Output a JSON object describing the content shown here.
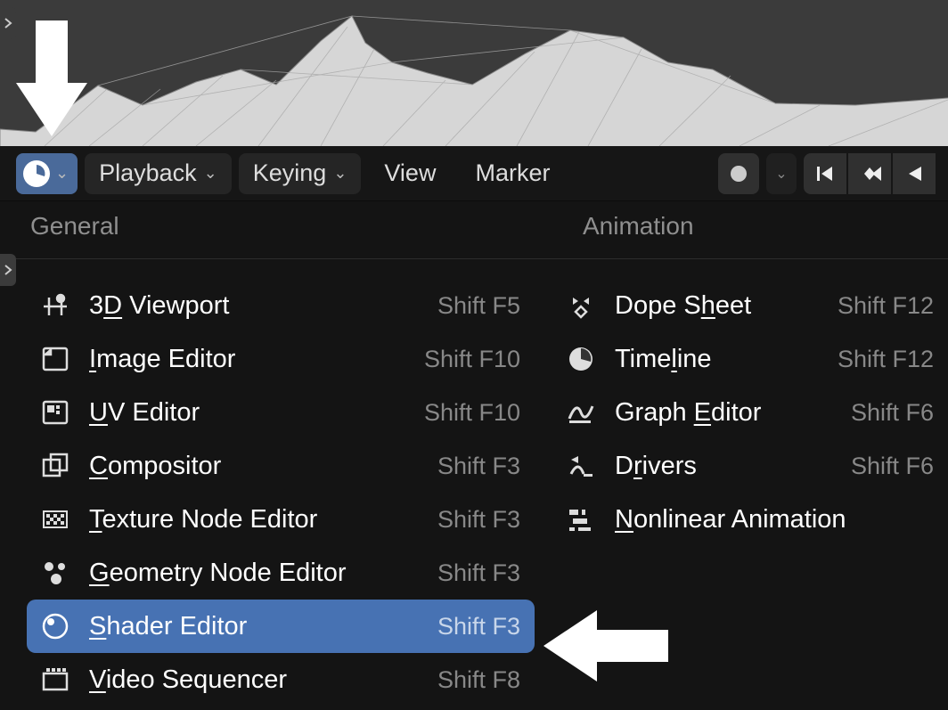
{
  "toolbar": {
    "editor_type_icon": "clock-icon",
    "playback": "Playback",
    "keying": "Keying",
    "view": "View",
    "marker": "Marker"
  },
  "dropdown": {
    "columns": [
      {
        "title": "General",
        "items": [
          {
            "icon": "viewport-3d-icon",
            "label_pre": "3",
            "label_ul": "D",
            "label_post": " Viewport",
            "shortcut": "Shift F5",
            "selected": false
          },
          {
            "icon": "image-editor-icon",
            "label_pre": "",
            "label_ul": "I",
            "label_post": "mage Editor",
            "shortcut": "Shift F10",
            "selected": false
          },
          {
            "icon": "uv-editor-icon",
            "label_pre": "",
            "label_ul": "U",
            "label_post": "V Editor",
            "shortcut": "Shift F10",
            "selected": false
          },
          {
            "icon": "compositor-icon",
            "label_pre": "",
            "label_ul": "C",
            "label_post": "ompositor",
            "shortcut": "Shift F3",
            "selected": false
          },
          {
            "icon": "texture-node-icon",
            "label_pre": "",
            "label_ul": "T",
            "label_post": "exture Node Editor",
            "shortcut": "Shift F3",
            "selected": false
          },
          {
            "icon": "geometry-node-icon",
            "label_pre": "",
            "label_ul": "G",
            "label_post": "eometry Node Editor",
            "shortcut": "Shift F3",
            "selected": false
          },
          {
            "icon": "shader-editor-icon",
            "label_pre": "",
            "label_ul": "S",
            "label_post": "hader Editor",
            "shortcut": "Shift F3",
            "selected": true
          },
          {
            "icon": "video-sequencer-icon",
            "label_pre": "",
            "label_ul": "V",
            "label_post": "ideo Sequencer",
            "shortcut": "Shift F8",
            "selected": false
          }
        ]
      },
      {
        "title": "Animation",
        "items": [
          {
            "icon": "dope-sheet-icon",
            "label_pre": "Dope S",
            "label_ul": "h",
            "label_post": "eet",
            "shortcut": "Shift F12",
            "selected": false
          },
          {
            "icon": "timeline-icon",
            "label_pre": "Time",
            "label_ul": "l",
            "label_post": "ine",
            "shortcut": "Shift F12",
            "selected": false
          },
          {
            "icon": "graph-editor-icon",
            "label_pre": "Graph ",
            "label_ul": "E",
            "label_post": "ditor",
            "shortcut": "Shift F6",
            "selected": false
          },
          {
            "icon": "drivers-icon",
            "label_pre": "D",
            "label_ul": "r",
            "label_post": "ivers",
            "shortcut": "Shift F6",
            "selected": false
          },
          {
            "icon": "nla-icon",
            "label_pre": "",
            "label_ul": "N",
            "label_post": "onlinear Animation",
            "shortcut": "",
            "selected": false
          }
        ]
      }
    ]
  }
}
